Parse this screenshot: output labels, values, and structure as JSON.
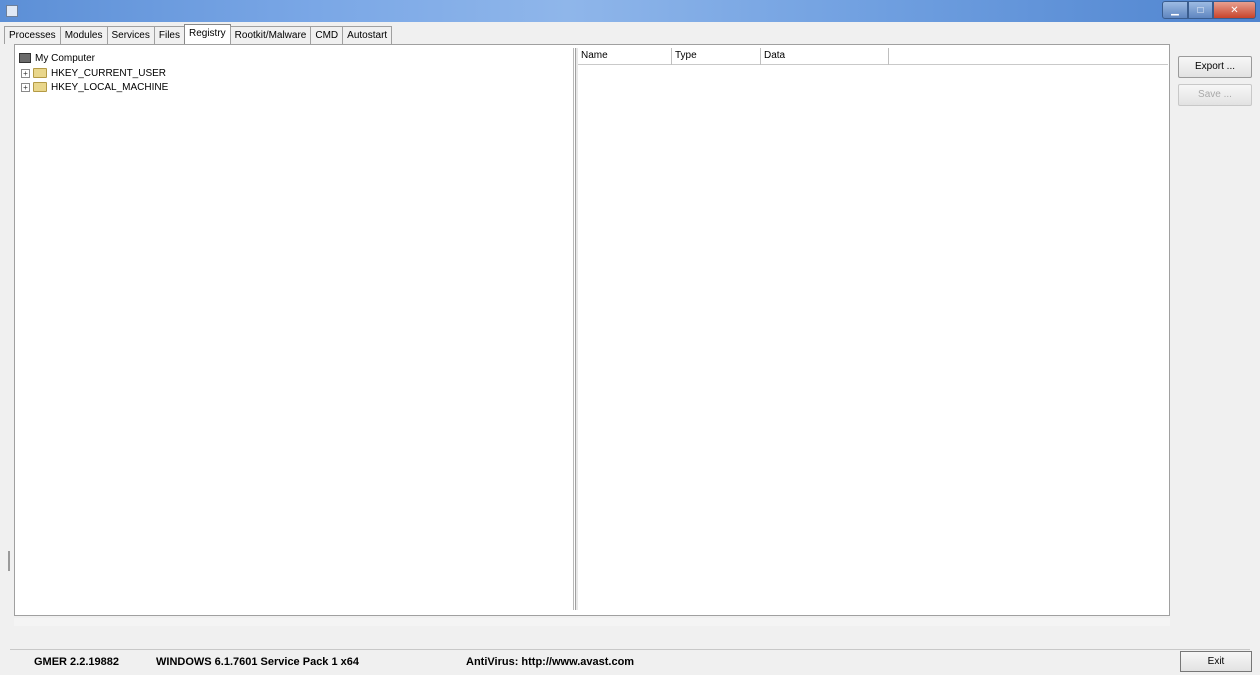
{
  "window": {
    "title": ""
  },
  "tabs": [
    {
      "label": "Processes"
    },
    {
      "label": "Modules"
    },
    {
      "label": "Services"
    },
    {
      "label": "Files"
    },
    {
      "label": "Registry"
    },
    {
      "label": "Rootkit/Malware"
    },
    {
      "label": "CMD"
    },
    {
      "label": "Autostart"
    }
  ],
  "tree": {
    "root": "My Computer",
    "items": [
      "HKEY_CURRENT_USER",
      "HKEY_LOCAL_MACHINE"
    ]
  },
  "list": {
    "columns": [
      "Name",
      "Type",
      "Data"
    ]
  },
  "buttons": {
    "export": "Export ...",
    "save": "Save ...",
    "exit": "Exit"
  },
  "status": {
    "version": "GMER 2.2.19882",
    "os": "WINDOWS 6.1.7601 Service Pack 1 x64",
    "antivirus": "AntiVirus: http://www.avast.com"
  },
  "colors": {
    "titlebar": "#7aa7e6",
    "close": "#c8442b",
    "folder": "#e9d68b"
  }
}
